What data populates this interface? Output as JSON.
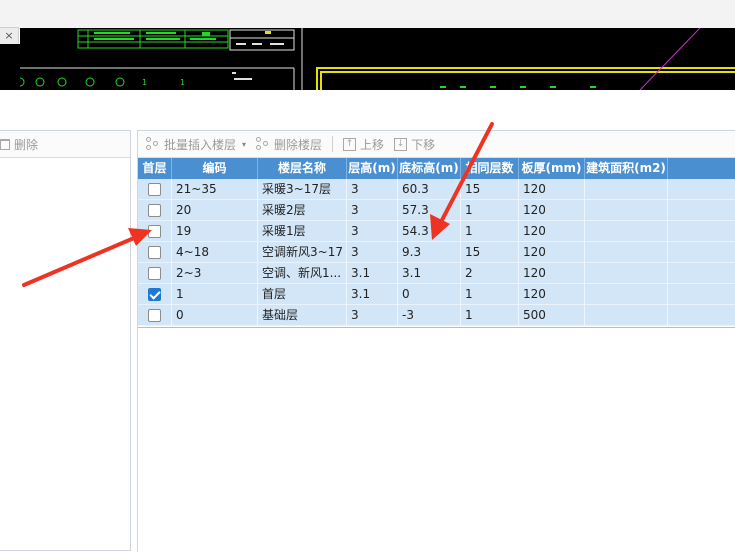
{
  "window": {
    "close_glyph": "×"
  },
  "cad": {
    "label_a": "1",
    "label_b": "1"
  },
  "left_toolbar": {
    "delete_label": "删除",
    "delete_icon": "trash-icon"
  },
  "right_toolbar": {
    "batch_insert_label": "批量插入楼层",
    "delete_floor_label": "删除楼层",
    "move_up_label": "上移",
    "move_down_label": "下移",
    "dropdown_glyph": "▾",
    "up_glyph": "↑",
    "down_glyph": "↓"
  },
  "table": {
    "columns": [
      "首层",
      "编码",
      "楼层名称",
      "层高(m)",
      "底标高(m)",
      "相同层数",
      "板厚(mm)",
      "建筑面积(m2)",
      ""
    ],
    "rows": [
      {
        "checked": false,
        "code": "21~35",
        "name": "采暖3~17层",
        "height": "3",
        "bottom": "60.3",
        "same": "15",
        "slab": "120",
        "area": ""
      },
      {
        "checked": false,
        "code": "20",
        "name": "采暖2层",
        "height": "3",
        "bottom": "57.3",
        "same": "1",
        "slab": "120",
        "area": ""
      },
      {
        "checked": false,
        "code": "19",
        "name": "采暖1层",
        "height": "3",
        "bottom": "54.3",
        "same": "1",
        "slab": "120",
        "area": ""
      },
      {
        "checked": false,
        "code": "4~18",
        "name": "空调新风3~17",
        "height": "3",
        "bottom": "9.3",
        "same": "15",
        "slab": "120",
        "area": ""
      },
      {
        "checked": false,
        "code": "2~3",
        "name": "空调、新风1...",
        "height": "3.1",
        "bottom": "3.1",
        "same": "2",
        "slab": "120",
        "area": ""
      },
      {
        "checked": true,
        "code": "1",
        "name": "首层",
        "height": "3.1",
        "bottom": "0",
        "same": "1",
        "slab": "120",
        "area": ""
      },
      {
        "checked": false,
        "code": "0",
        "name": "基础层",
        "height": "3",
        "bottom": "-3",
        "same": "1",
        "slab": "500",
        "area": ""
      }
    ]
  },
  "colors": {
    "header_bg": "#4a90d0",
    "row_bg": "#d3e6f7",
    "checkbox_on": "#1e78d6",
    "arrow": "#ee3322",
    "cad_green": "#2bd42b",
    "cad_yellow": "#e8e000",
    "cad_magenta": "#d22cd2"
  }
}
